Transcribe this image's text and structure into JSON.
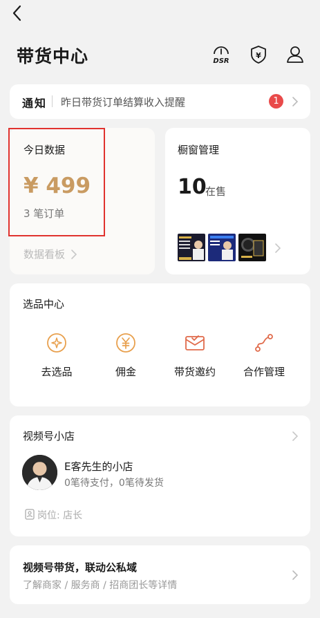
{
  "header": {
    "title": "带货中心",
    "dsr_label": "DSR",
    "yen_symbol": "¥"
  },
  "notice": {
    "title": "通知",
    "text": "昨日带货订单结算收入提醒",
    "badge_count": "1"
  },
  "today_data": {
    "title": "今日数据",
    "amount": "¥ 499",
    "orders": "3 笔订单",
    "board_link": "数据看板"
  },
  "showcase": {
    "title": "橱窗管理",
    "count": "10",
    "status": "在售"
  },
  "selection": {
    "title": "选品中心",
    "items": [
      {
        "label": "去选品"
      },
      {
        "label": "佣金"
      },
      {
        "label": "带货邀约"
      },
      {
        "label": "合作管理"
      }
    ]
  },
  "shop": {
    "title": "视频号小店",
    "name": "E客先生的小店",
    "status": "0笔待支付，0笔待发货",
    "role": "岗位: 店长"
  },
  "promo": {
    "title": "视频号带货，联动公私域",
    "subtitle": "了解商家 / 服务商 / 招商团长等详情"
  },
  "colors": {
    "accent": "#c99b62",
    "badge": "#e94a4a",
    "highlight": "#e0322e",
    "icon": "#e8a04e"
  }
}
